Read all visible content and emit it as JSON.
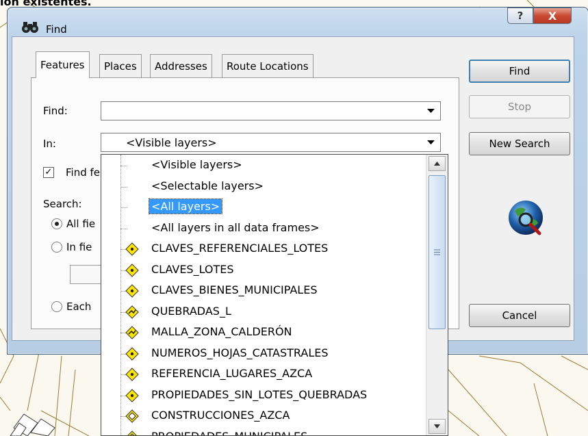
{
  "background": {
    "caption": "ion existentes."
  },
  "window": {
    "title": "Find",
    "help_label": "?",
    "close_label": "X"
  },
  "tabs": [
    {
      "label": "Features",
      "active": true
    },
    {
      "label": "Places",
      "active": false
    },
    {
      "label": "Addresses",
      "active": false
    },
    {
      "label": "Route Locations",
      "active": false
    }
  ],
  "form": {
    "find_label": "Find:",
    "find_value": "",
    "in_label": "In:",
    "in_value": "<Visible layers>",
    "find_features_label": "Find fe",
    "find_features_checked": true,
    "search_label": "Search:",
    "radio_all_fields_label": "All fie",
    "radio_in_field_label": "In fie",
    "radio_each_label": "Each"
  },
  "buttons": {
    "find": "Find",
    "stop": "Stop",
    "new_search": "New Search",
    "cancel": "Cancel"
  },
  "dropdown": {
    "items": [
      {
        "label": "<Visible layers>",
        "icon": "none"
      },
      {
        "label": "<Selectable layers>",
        "icon": "none"
      },
      {
        "label": "<All layers>",
        "icon": "none",
        "selected": true
      },
      {
        "label": "<All layers in all data frames>",
        "icon": "none"
      },
      {
        "label": "CLAVES_REFERENCIALES_LOTES",
        "icon": "point-layer-icon"
      },
      {
        "label": "CLAVES_LOTES",
        "icon": "point-layer-icon"
      },
      {
        "label": "CLAVES_BIENES_MUNICIPALES",
        "icon": "point-layer-icon"
      },
      {
        "label": "QUEBRADAS_L",
        "icon": "line-layer-icon"
      },
      {
        "label": "MALLA_ZONA_CALDERÓN",
        "icon": "line-layer-icon"
      },
      {
        "label": "NUMEROS_HOJAS_CATASTRALES",
        "icon": "point-layer-icon"
      },
      {
        "label": "REFERENCIA_LUGARES_AZCA",
        "icon": "point-layer-icon"
      },
      {
        "label": "PROPIEDADES_SIN_LOTES_QUEBRADAS",
        "icon": "point-layer-icon"
      },
      {
        "label": "CONSTRUCCIONES_AZCA",
        "icon": "polygon-layer-icon"
      },
      {
        "label": "PROPIEDADES_MUNICIPALES",
        "icon": "polygon-layer-icon"
      }
    ]
  },
  "colors": {
    "selection": "#3399ff",
    "layer_icon_fill": "#ffe600",
    "close_button": "#c94a31"
  }
}
